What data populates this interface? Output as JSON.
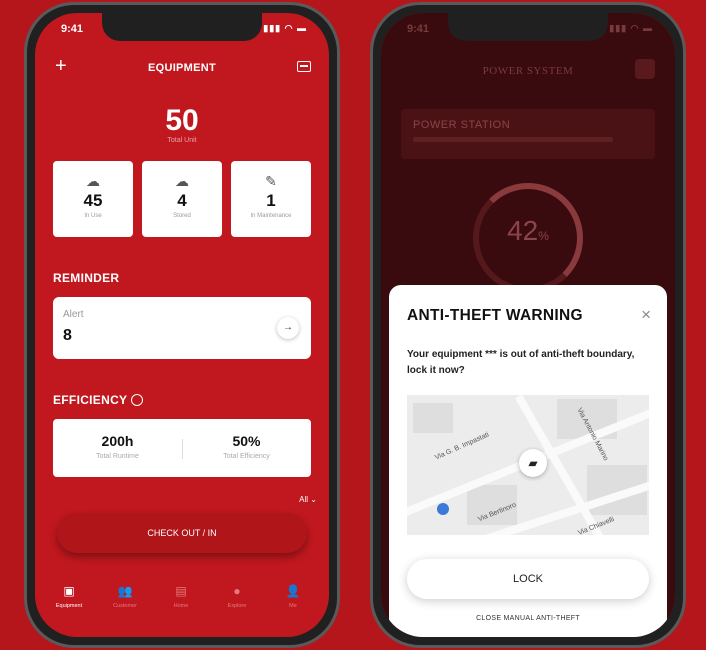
{
  "left": {
    "status": {
      "time": "9:41",
      "icons": "▮▮▮ ◠ ▬"
    },
    "header": {
      "title": "EQUIPMENT",
      "add": "+"
    },
    "total": {
      "value": "50",
      "label": "Total Unit"
    },
    "stats": [
      {
        "icon": "☁",
        "value": "45",
        "label": "In Use"
      },
      {
        "icon": "☁",
        "value": "4",
        "label": "Stored"
      },
      {
        "icon": "✎",
        "value": "1",
        "label": "In Maintenance"
      }
    ],
    "reminder": {
      "heading": "REMINDER",
      "alert_label": "Alert",
      "alert_value": "8",
      "arrow": "→"
    },
    "efficiency": {
      "heading": "EFFICIENCY",
      "runtime_value": "200h",
      "runtime_label": "Total Runtime",
      "eff_value": "50%",
      "eff_label": "Total Efficiency"
    },
    "filter": "All ⌄",
    "checkout": "CHECK OUT / IN",
    "tabs": [
      {
        "icon": "▣",
        "label": "Equipment"
      },
      {
        "icon": "👥",
        "label": "Customer"
      },
      {
        "icon": "▤",
        "label": "Home"
      },
      {
        "icon": "●",
        "label": "Explore"
      },
      {
        "icon": "👤",
        "label": "Me"
      }
    ]
  },
  "right": {
    "status": {
      "time": "9:41",
      "icons": "▮▮▮ ◠ ▬"
    },
    "title": "POWER SYSTEM",
    "station": "POWER STATION",
    "gauge_value": "42",
    "gauge_unit": "%",
    "modal": {
      "title": "ANTI-THEFT WARNING",
      "close": "×",
      "message": "Your equipment *** is out of anti-theft boundary, lock it now?",
      "map_labels": [
        "Via G. B. Impastati",
        "Via Antonio Marino",
        "Via Bertinoro",
        "Via Chiavelli"
      ],
      "lock_label": "LOCK",
      "close_manual": "CLOSE MANUAL ANTI-THEFT"
    }
  }
}
